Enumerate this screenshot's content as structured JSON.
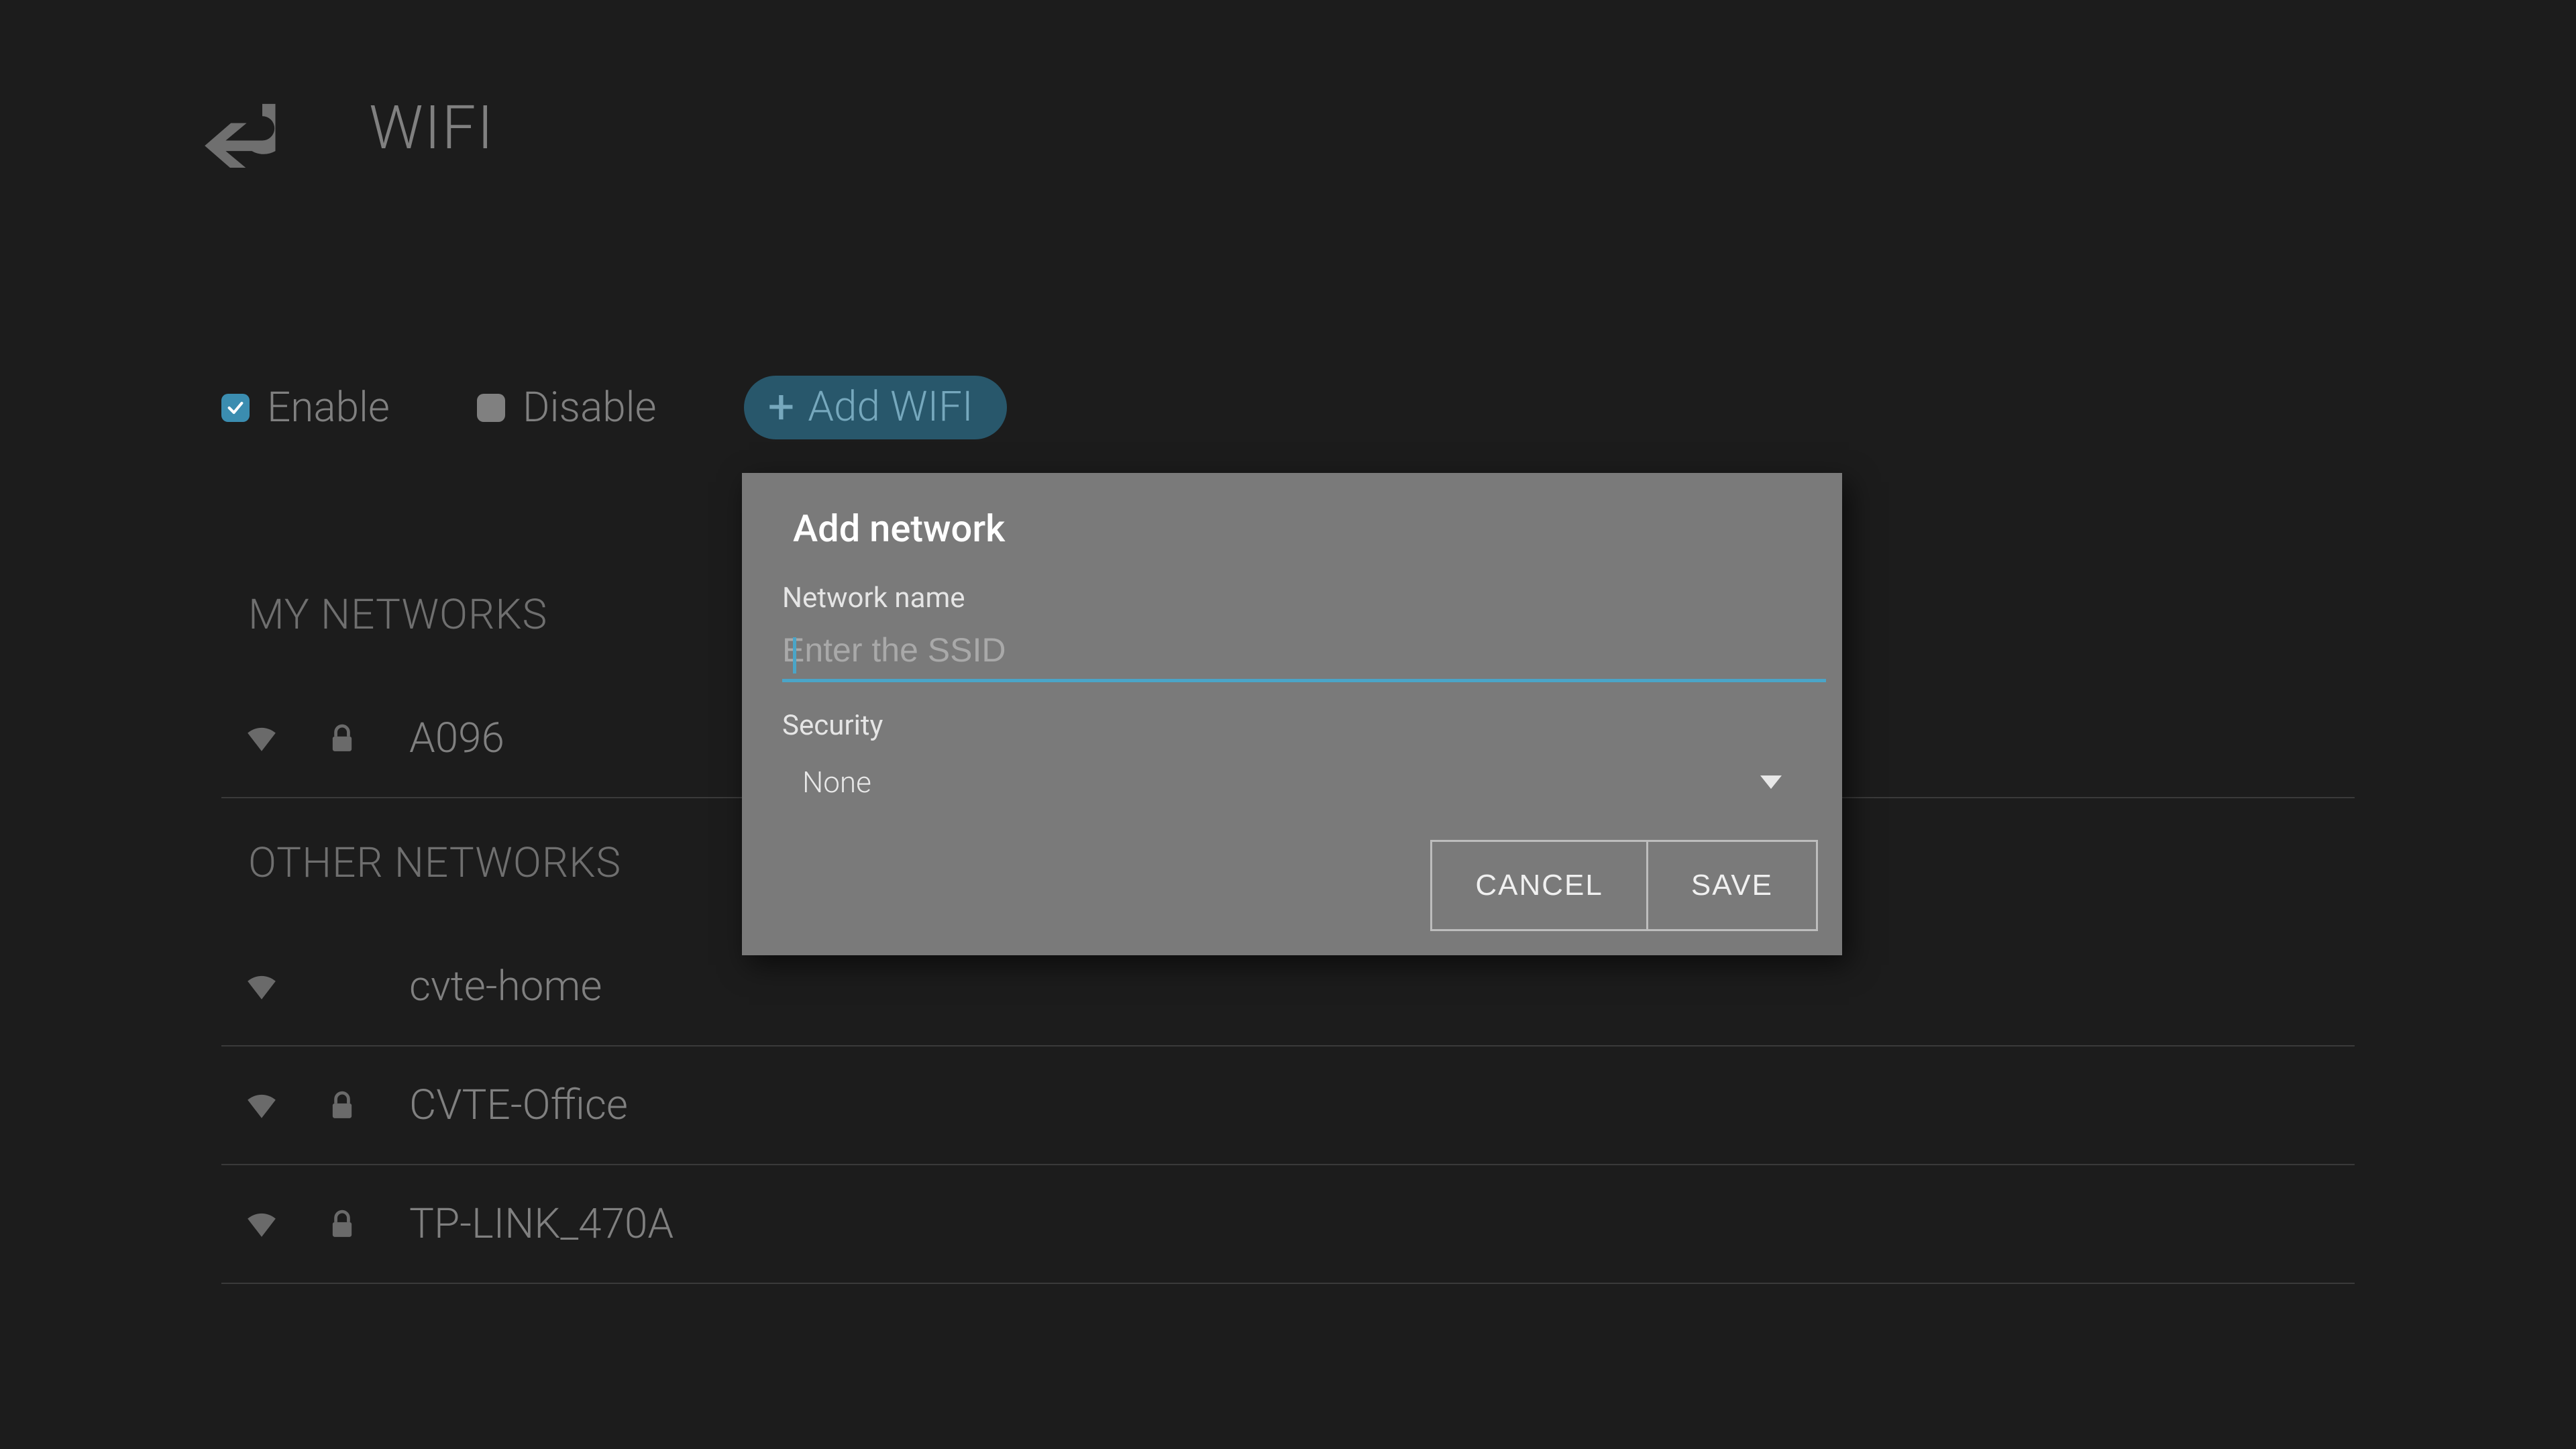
{
  "header": {
    "title": "WIFI"
  },
  "controls": {
    "enable_label": "Enable",
    "disable_label": "Disable",
    "add_label": "Add WIFI",
    "enabled": true
  },
  "sections": {
    "my_label": "MY NETWORKS",
    "other_label": "OTHER NETWORKS"
  },
  "my_networks": [
    {
      "name": "A096",
      "locked": true
    }
  ],
  "other_networks": [
    {
      "name": "cvte-home",
      "locked": false
    },
    {
      "name": "CVTE-Office",
      "locked": true
    },
    {
      "name": "TP-LINK_470A",
      "locked": true
    }
  ],
  "dialog": {
    "title": "Add network",
    "name_label": "Network name",
    "name_placeholder": "Enter the SSID",
    "name_value": "",
    "security_label": "Security",
    "security_value": "None",
    "cancel": "CANCEL",
    "save": "SAVE"
  }
}
